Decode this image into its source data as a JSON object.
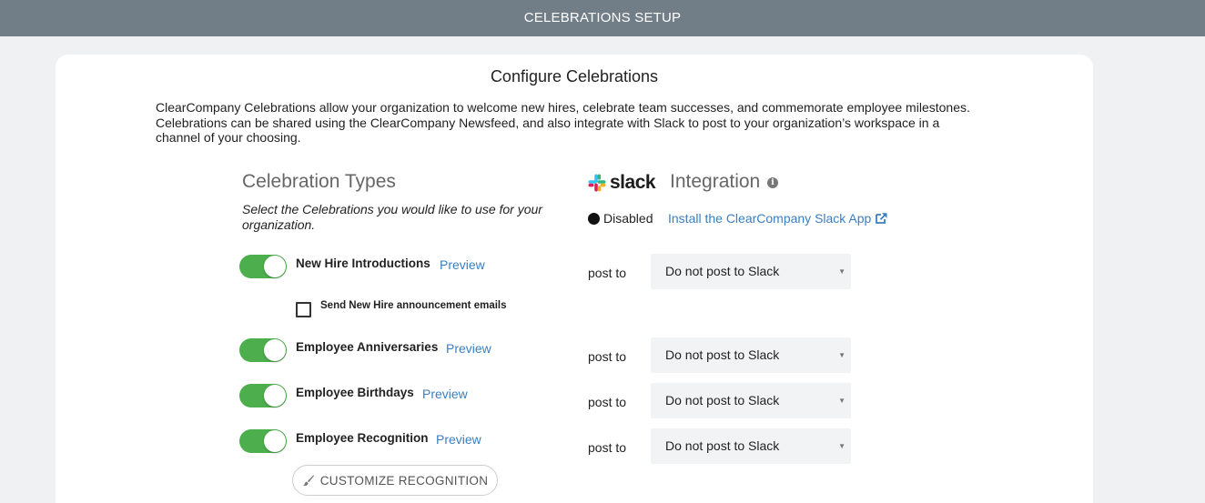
{
  "header": {
    "title": "CELEBRATIONS SETUP"
  },
  "card": {
    "title": "Configure Celebrations",
    "intro": "ClearCompany Celebrations allow your organization to welcome new hires, celebrate team successes, and commemorate employee milestones. Celebrations can be shared using the ClearCompany Newsfeed, and also integrate with Slack to post to your organization’s workspace in a channel of your choosing."
  },
  "types": {
    "title": "Celebration Types",
    "subtitle": "Select the Celebrations you would like to use for your organization.",
    "items": [
      {
        "label": "New Hire Introductions",
        "preview": "Preview",
        "enabled": true
      },
      {
        "label": "Employee Anniversaries",
        "preview": "Preview",
        "enabled": true
      },
      {
        "label": "Employee Birthdays",
        "preview": "Preview",
        "enabled": true
      },
      {
        "label": "Employee Recognition",
        "preview": "Preview",
        "enabled": true
      }
    ],
    "new_hire_email_label": "Send New Hire announcement emails",
    "new_hire_email_checked": false,
    "customize_label": "CUSTOMIZE RECOGNITION"
  },
  "integration": {
    "brand": "slack",
    "title": "Integration",
    "status": "Disabled",
    "install_link": "Install the ClearCompany Slack App",
    "post_to_label": "post to",
    "selects": [
      "Do not post to Slack",
      "Do not post to Slack",
      "Do not post to Slack",
      "Do not post to Slack"
    ]
  },
  "colors": {
    "header_bg": "#727e87",
    "toggle_on": "#4cae4c",
    "link": "#3a7fc1"
  }
}
